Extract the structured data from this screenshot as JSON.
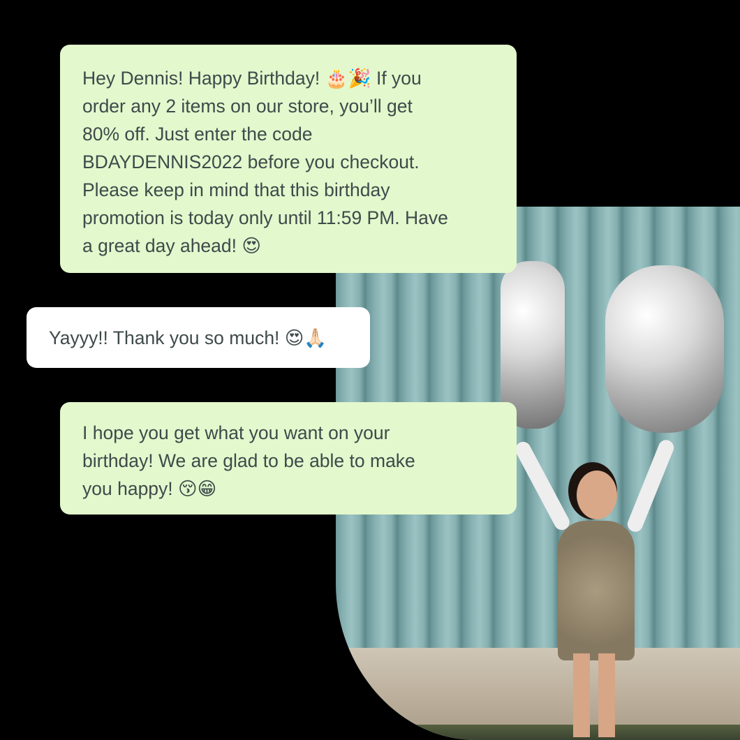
{
  "conversation": {
    "messages": [
      {
        "sender": "business",
        "text": "Hey Dennis! Happy Birthday! 🎂🎉 If you\norder any 2 items on our store, you’ll get\n80% off. Just enter the code\nBDAYDENNIS2022 before you checkout.\nPlease keep in mind that this birthday\npromotion is today only until 11:59 PM. Have\na great day ahead! 😍"
      },
      {
        "sender": "customer",
        "text": "Yayyy!! Thank you so much! 😍🙏🏻"
      },
      {
        "sender": "business",
        "text": "I hope you get what you want on your\nbirthday! We are glad to be able to make\nyou happy! 😚😁"
      }
    ]
  },
  "colors": {
    "background": "#000000",
    "business_bubble": "#e3f8cd",
    "customer_bubble": "#ffffff",
    "text": "#3f4a4a"
  }
}
